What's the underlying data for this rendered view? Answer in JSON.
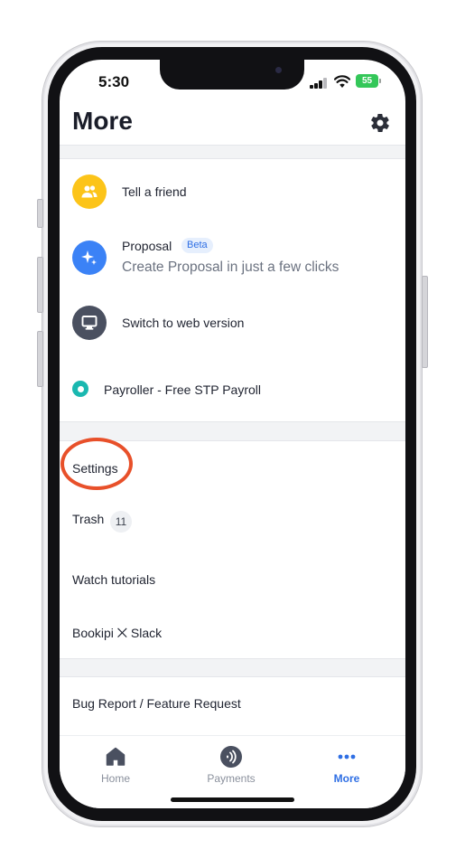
{
  "status_bar": {
    "time": "5:30",
    "battery": "55"
  },
  "header": {
    "title": "More"
  },
  "feature_items": [
    {
      "label": "Tell a friend"
    },
    {
      "label": "Proposal",
      "badge": "Beta",
      "sublabel": "Create Proposal in just a few clicks"
    },
    {
      "label": "Switch to web version"
    },
    {
      "label": "Payroller - Free STP Payroll"
    }
  ],
  "menu_items": [
    {
      "label": "Settings"
    },
    {
      "label": "Trash",
      "count": "11"
    },
    {
      "label": "Watch tutorials"
    },
    {
      "label": "Bookipi ⨉ Slack"
    }
  ],
  "support_items": [
    {
      "label": "Bug Report / Feature Request"
    }
  ],
  "tabbar": [
    {
      "label": "Home",
      "icon": "home-icon"
    },
    {
      "label": "Payments",
      "icon": "payments-icon"
    },
    {
      "label": "More",
      "icon": "more-dots-icon",
      "active": true
    }
  ],
  "colors": {
    "accent": "#2f6fe4",
    "tell_friend_icon_bg": "#fcc419",
    "proposal_icon_bg": "#3b82f6",
    "web_version_icon_bg": "#4a5060",
    "payroller_dot": "#1ab8b0",
    "highlight_ring": "#e8502a"
  }
}
